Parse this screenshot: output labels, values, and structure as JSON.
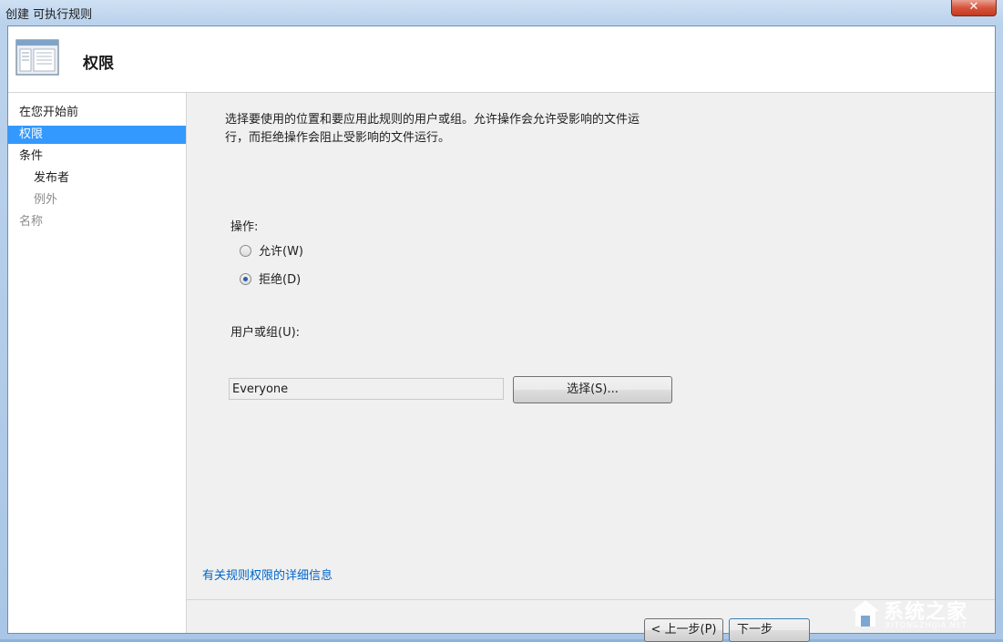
{
  "window": {
    "title": "创建 可执行规则"
  },
  "header": {
    "title": "权限"
  },
  "sidebar": {
    "items": [
      {
        "label": "在您开始前",
        "state": "normal",
        "level": 0
      },
      {
        "label": "权限",
        "state": "selected",
        "level": 0
      },
      {
        "label": "条件",
        "state": "normal",
        "level": 0
      },
      {
        "label": "发布者",
        "state": "normal",
        "level": 1
      },
      {
        "label": "例外",
        "state": "disabled",
        "level": 1
      },
      {
        "label": "名称",
        "state": "disabled",
        "level": 0
      }
    ]
  },
  "main": {
    "description": "选择要使用的位置和要应用此规则的用户或组。允许操作会允许受影响的文件运行，而拒绝操作会阻止受影响的文件运行。",
    "action_label": "操作:",
    "options": [
      {
        "label": "允许(W)",
        "checked": false
      },
      {
        "label": "拒绝(D)",
        "checked": true
      }
    ],
    "user_group_label": "用户或组(U):",
    "user_group_value": "Everyone",
    "select_button": "选择(S)...",
    "info_link": "有关规则权限的详细信息"
  },
  "footer": {
    "back_button": "< 上一步(P)",
    "next_button": "下一步"
  },
  "watermark": {
    "text": "系统之家",
    "sub": "XITONGZHIJIA.NET"
  },
  "colors": {
    "selection": "#3399ff",
    "link": "#0066cc",
    "radio_dot": "#2a5fa8"
  }
}
